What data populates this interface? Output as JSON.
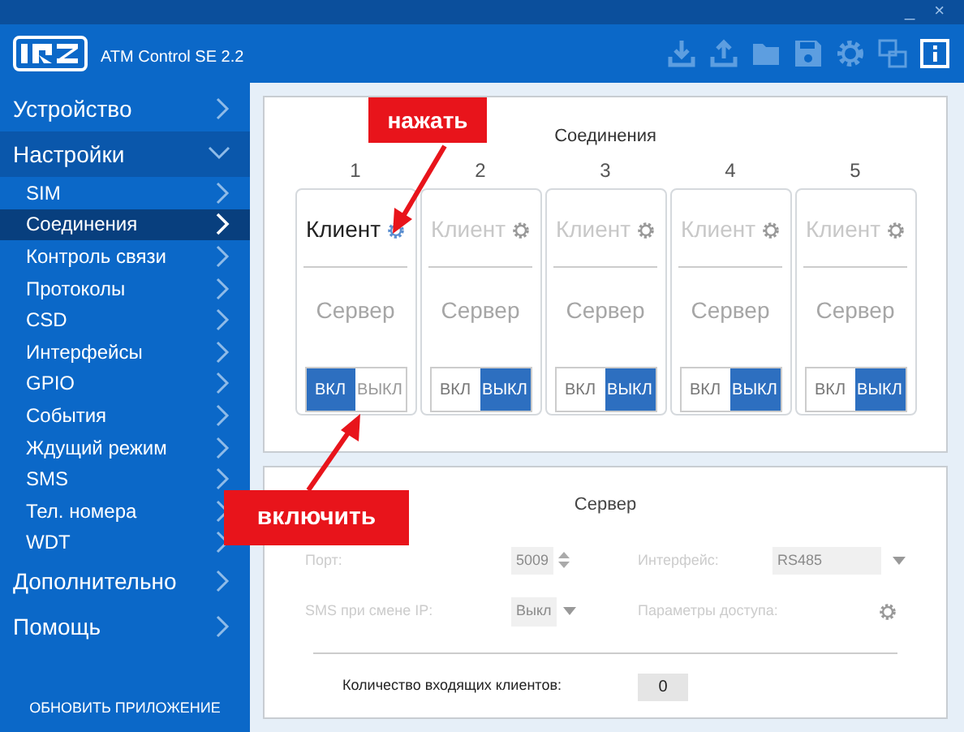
{
  "window": {
    "app_name": "ATM Control SE 2.2",
    "controls": [
      "_",
      "×"
    ]
  },
  "toolbar": [
    {
      "kind": "download",
      "selected": false
    },
    {
      "kind": "upload",
      "selected": false
    },
    {
      "kind": "folder",
      "selected": false
    },
    {
      "kind": "save",
      "selected": false
    },
    {
      "kind": "settings",
      "selected": false
    },
    {
      "kind": "language",
      "selected": false
    },
    {
      "kind": "info",
      "selected": true
    }
  ],
  "sidebar": {
    "items": [
      {
        "label": "Устройство",
        "expanded": false
      },
      {
        "label": "Настройки",
        "expanded": true,
        "children": [
          {
            "label": "SIM",
            "selected": false
          },
          {
            "label": "Соединения",
            "selected": true
          },
          {
            "label": "Контроль связи",
            "selected": false
          },
          {
            "label": "Протоколы",
            "selected": false
          },
          {
            "label": "CSD",
            "selected": false
          },
          {
            "label": "Интерфейсы",
            "selected": false
          },
          {
            "label": "GPIO",
            "selected": false
          },
          {
            "label": "События",
            "selected": false
          },
          {
            "label": "Ждущий режим",
            "selected": false
          },
          {
            "label": "SMS",
            "selected": false
          },
          {
            "label": "Тел. номера",
            "selected": false
          },
          {
            "label": "WDT",
            "selected": false
          }
        ]
      },
      {
        "label": "Дополнительно",
        "expanded": false
      },
      {
        "label": "Помощь",
        "expanded": false
      }
    ],
    "update_link": "ОБНОВИТЬ ПРИЛОЖЕНИЕ"
  },
  "connections": {
    "title": "Соединения",
    "items": [
      {
        "number": "1",
        "client": "Клиент",
        "server": "Сервер",
        "on": true,
        "on_label": "ВКЛ",
        "off_label": "ВЫКЛ"
      },
      {
        "number": "2",
        "client": "Клиент",
        "server": "Сервер",
        "on": false,
        "on_label": "ВКЛ",
        "off_label": "ВЫКЛ"
      },
      {
        "number": "3",
        "client": "Клиент",
        "server": "Сервер",
        "on": false,
        "on_label": "ВКЛ",
        "off_label": "ВЫКЛ"
      },
      {
        "number": "4",
        "client": "Клиент",
        "server": "Сервер",
        "on": false,
        "on_label": "ВКЛ",
        "off_label": "ВЫКЛ"
      },
      {
        "number": "5",
        "client": "Клиент",
        "server": "Сервер",
        "on": false,
        "on_label": "ВКЛ",
        "off_label": "ВЫКЛ"
      }
    ]
  },
  "server": {
    "title": "Сервер",
    "port_label": "Порт:",
    "port": "5009",
    "interface_label": "Интерфейс:",
    "interface": "RS485",
    "sms_label": "SMS при смене IP:",
    "sms": "Выкл",
    "access_label": "Параметры доступа:",
    "clients_label": "Количество входящих клиентов:",
    "clients": "0"
  },
  "callouts": [
    {
      "text": "нажать"
    },
    {
      "text": "включить"
    }
  ]
}
